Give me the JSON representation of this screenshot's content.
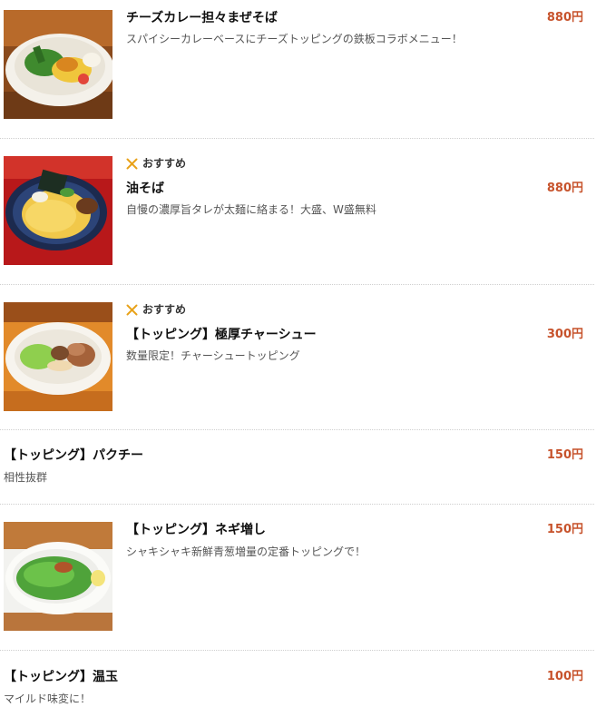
{
  "colors": {
    "price": "#c7532c",
    "badge_icon": "#e8a21a",
    "divider": "#cfcfcf"
  },
  "menu_items": [
    {
      "title": "チーズカレー担々まぜそば",
      "description": "スパイシーカレーベースにチーズトッピングの鉄板コラボメニュー！",
      "price": "880円",
      "badge": "",
      "has_image": true
    },
    {
      "title": "油そば",
      "description": "自慢の濃厚旨タレが太麺に絡まる！大盛、W盛無料",
      "price": "880円",
      "badge": "おすすめ",
      "badge_icon": "fork-knife-icon",
      "has_image": true
    },
    {
      "title": "【トッピング】極厚チャーシュー",
      "description": "数量限定！チャーシュートッピング",
      "price": "300円",
      "badge": "おすすめ",
      "badge_icon": "fork-knife-icon",
      "has_image": true
    },
    {
      "title": "【トッピング】パクチー",
      "description": "相性抜群",
      "price": "150円",
      "badge": "",
      "has_image": false
    },
    {
      "title": "【トッピング】ネギ増し",
      "description": "シャキシャキ新鮮青葱増量の定番トッピングで！",
      "price": "150円",
      "badge": "",
      "has_image": true
    },
    {
      "title": "【トッピング】温玉",
      "description": "マイルド味変に！",
      "price": "100円",
      "badge": "",
      "has_image": false
    }
  ]
}
